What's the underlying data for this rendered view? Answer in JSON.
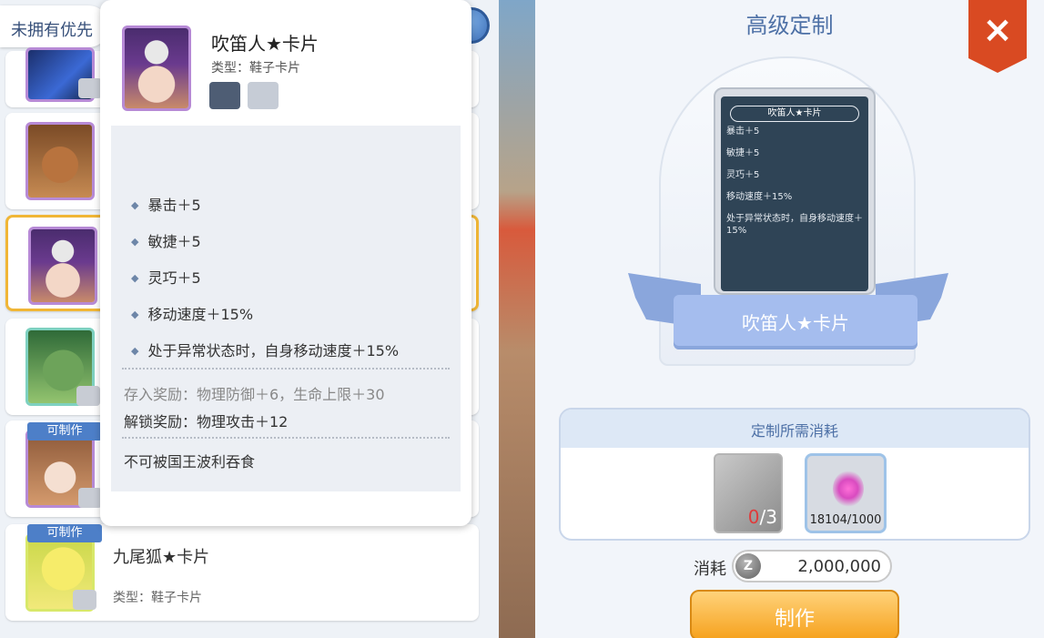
{
  "filter": {
    "label": "未拥有优先"
  },
  "list": {
    "rows": [
      {
        "badge": "",
        "name": "",
        "type": ""
      },
      {
        "badge": "",
        "name": "",
        "type": ""
      },
      {
        "badge": "",
        "name": "",
        "type": ""
      },
      {
        "badge": "",
        "name": "",
        "type": ""
      },
      {
        "badge": "可制作",
        "name": "",
        "type": ""
      },
      {
        "badge": "可制作",
        "name": "九尾狐★卡片",
        "type": "类型：鞋子卡片"
      }
    ]
  },
  "tooltip": {
    "name": "吹笛人★卡片",
    "type": "类型：鞋子卡片",
    "stats": [
      "暴击＋5",
      "敏捷＋5",
      "灵巧＋5",
      "移动速度＋15%",
      "处于异常状态时，自身移动速度＋15%"
    ],
    "deposit_bonus": "存入奖励：物理防御＋6，生命上限＋30",
    "unlock_bonus": "解锁奖励：物理攻击＋12",
    "note": "不可被国王波利吞食"
  },
  "panel": {
    "title": "高级定制",
    "close_icon": "×",
    "card_preview": {
      "title": "吹笛人★卡片",
      "lines": [
        "暴击＋5",
        "敏捷＋5",
        "灵巧＋5",
        "移动速度＋15%",
        "处于异常状态时，自身移动速度＋15%"
      ]
    },
    "ribbon_name": "吹笛人★卡片",
    "cost_title": "定制所需消耗",
    "materials": [
      {
        "owned": "0",
        "required": "/3"
      },
      {
        "count": "18104/1000"
      }
    ],
    "fee_label": "消耗",
    "fee_icon": "Z",
    "fee_value": "2,000,000",
    "make_button": "制作"
  }
}
